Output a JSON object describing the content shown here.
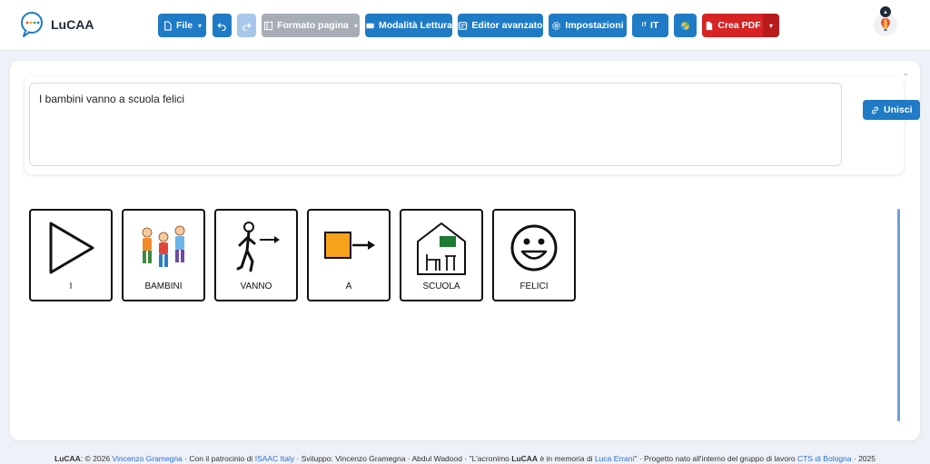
{
  "app": {
    "name": "LuCAA"
  },
  "toolbar": {
    "file_label": "File",
    "formato_label": "Formato pagina",
    "lettura_label": "Modalità Lettura",
    "editor_label": "Editor avanzato",
    "impostazioni_label": "Impostazioni",
    "lang_icon_text": "IT",
    "lang_label": "IT",
    "pdf_label": "Crea PDF"
  },
  "editor": {
    "sentence": "I bambini vanno a scuola felici",
    "join_label": "Unisci"
  },
  "symbols": [
    {
      "word": "I",
      "icon": "play-triangle-icon"
    },
    {
      "word": "BAMBINI",
      "icon": "children-icon"
    },
    {
      "word": "VANNO",
      "icon": "walking-person-icon"
    },
    {
      "word": "A",
      "icon": "square-arrow-icon"
    },
    {
      "word": "SCUOLA",
      "icon": "school-icon"
    },
    {
      "word": "FELICI",
      "icon": "smiley-face-icon"
    }
  ],
  "footer": {
    "brand": "LuCAA",
    "copyright": ": © 2026",
    "author": "Vincenzo Gramegna",
    "patronage_text": "Con il patrocinio di",
    "patronage_org": "ISAAC Italy",
    "dev_text": "Sviluppo: Vincenzo Gramegna · Abdul Wadood",
    "memory_text_1": "\"L'acronimo",
    "memory_brand": "LuCAA",
    "memory_text_2": "è in memoria di",
    "memory_name": "Luca Errani",
    "memory_close": "\"",
    "project_text": "Progetto nato all'interno del gruppo di lavoro",
    "project_org": "CTS di Bologna",
    "project_year": "· 2025",
    "sep": "·"
  },
  "colors": {
    "primary": "#1f7bc6",
    "disabled": "#a7adb5",
    "danger": "#d62323",
    "link": "#2e6fd1"
  }
}
